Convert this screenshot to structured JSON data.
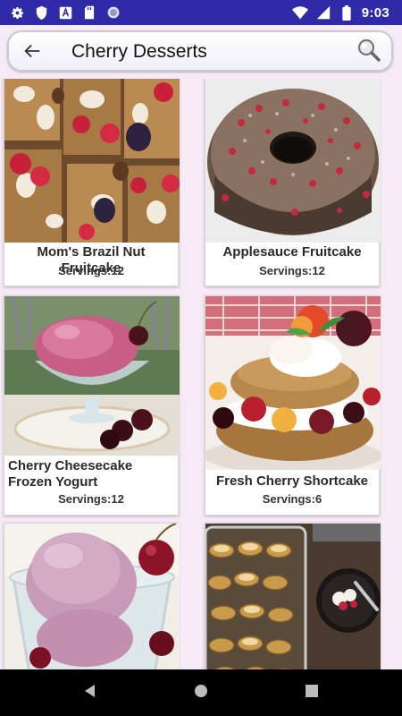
{
  "status_bar": {
    "time": "9:03",
    "icons": [
      "gear-icon",
      "shield-icon",
      "font-a-icon",
      "sd-card-icon",
      "circle-icon",
      "wifi-icon",
      "signal-icon",
      "battery-icon"
    ]
  },
  "header": {
    "title": "Cherry Desserts",
    "back_icon": "arrow-left-icon",
    "search_icon": "magnifier-icon"
  },
  "recipes": [
    {
      "name": "Mom's Brazil Nut Fruitcake",
      "servings": "Servings:12"
    },
    {
      "name": "Applesauce Fruitcake",
      "servings": "Servings:12"
    },
    {
      "name": "Cherry Cheesecake Frozen Yogurt",
      "servings": "Servings:12"
    },
    {
      "name": "Fresh Cherry Shortcake",
      "servings": "Servings:6"
    },
    {
      "name": "",
      "servings": ""
    },
    {
      "name": "",
      "servings": ""
    }
  ],
  "nav_bar": {
    "icons": [
      "back-triangle-icon",
      "home-circle-icon",
      "recents-square-icon"
    ]
  },
  "colors": {
    "status_bar": "#2F2AA8",
    "background": "#F6EAF6",
    "nav_bar": "#000000"
  }
}
